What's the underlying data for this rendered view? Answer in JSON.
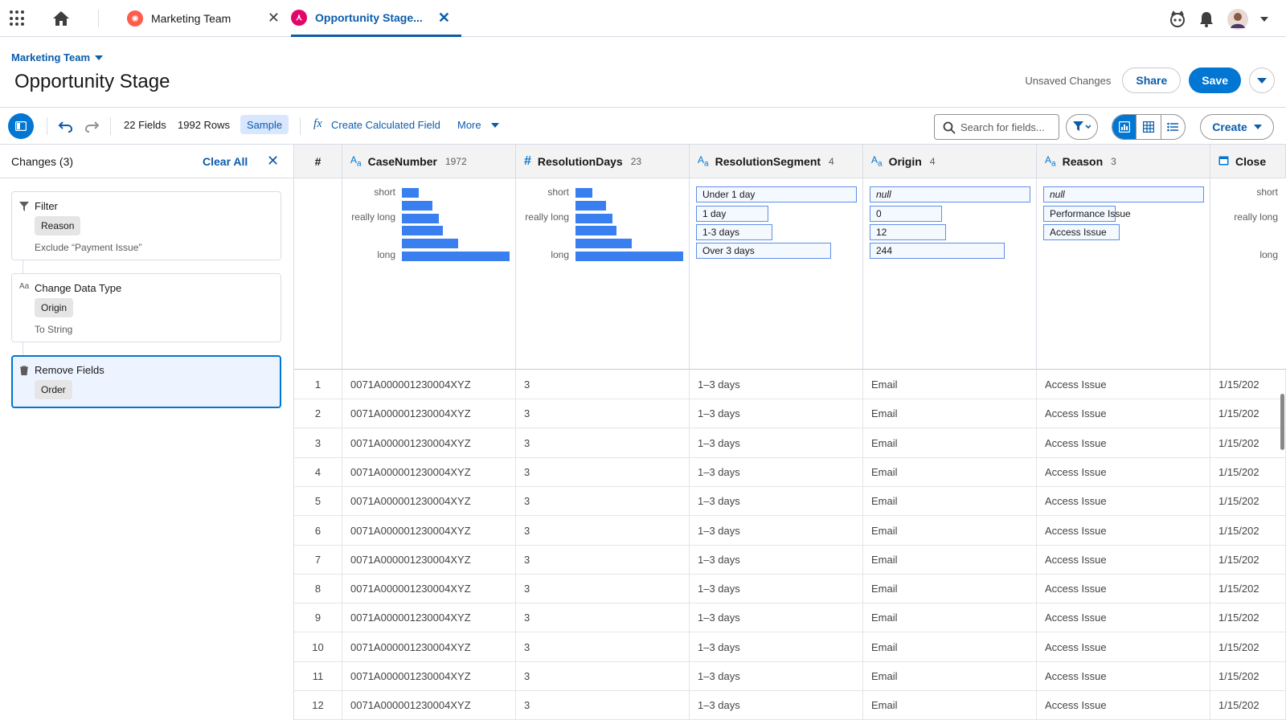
{
  "tabs": [
    {
      "label": "Marketing Team"
    },
    {
      "label": "Opportunity Stage..."
    }
  ],
  "header": {
    "breadcrumb": "Marketing Team",
    "title": "Opportunity Stage",
    "unsaved": "Unsaved Changes",
    "share_label": "Share",
    "save_label": "Save"
  },
  "toolbar": {
    "fields": "22 Fields",
    "rows": "1992 Rows",
    "sample": "Sample",
    "fx": "fx",
    "calc_field": "Create Calculated Field",
    "more": "More",
    "search_placeholder": "Search for fields...",
    "create_label": "Create"
  },
  "changes": {
    "title": "Changes (3)",
    "clear_all": "Clear All",
    "close": "✕",
    "items": [
      {
        "title": "Filter",
        "pill": "Reason",
        "desc": "Exclude “Payment Issue”",
        "icon": "filter-icon"
      },
      {
        "title": "Change Data Type",
        "pill": "Origin",
        "desc": "To String",
        "icon": "text-type-icon"
      },
      {
        "title": "Remove Fields",
        "pill": "Order",
        "desc": "",
        "icon": "trash-icon"
      }
    ]
  },
  "columns": [
    {
      "name": "#",
      "type": "",
      "count": ""
    },
    {
      "name": "CaseNumber",
      "type": "text",
      "count": "1972"
    },
    {
      "name": "ResolutionDays",
      "type": "number",
      "count": "23"
    },
    {
      "name": "ResolutionSegment",
      "type": "text",
      "count": "4"
    },
    {
      "name": "Origin",
      "type": "text",
      "count": "4"
    },
    {
      "name": "Reason",
      "type": "text",
      "count": "3"
    },
    {
      "name": "Close",
      "type": "date",
      "count": ""
    }
  ],
  "profiles": {
    "casenumber": {
      "labels": [
        "short",
        "really long",
        "long"
      ],
      "bar_fractions": [
        0.16,
        0.28,
        0.34,
        0.38,
        0.52,
        1.0
      ]
    },
    "resolutiondays": {
      "labels": [
        "short",
        "really long",
        "long"
      ],
      "bar_fractions": [
        0.16,
        0.28,
        0.34,
        0.38,
        0.52,
        1.0
      ]
    },
    "segment": [
      "Under 1 day",
      "1 day",
      "1-3 days",
      "Over 3 days"
    ],
    "origin": [
      "null",
      "0",
      "12",
      "244"
    ],
    "reason": [
      "null",
      "Performance Issue",
      "Access Issue"
    ],
    "close": {
      "labels": [
        "short",
        "really long",
        "long"
      ]
    }
  },
  "rows": [
    {
      "n": "1",
      "case": "0071A000001230004XYZ",
      "days": "3",
      "seg": "1–3 days",
      "origin": "Email",
      "reason": "Access Issue",
      "close": "1/15/202"
    },
    {
      "n": "2",
      "case": "0071A000001230004XYZ",
      "days": "3",
      "seg": "1–3 days",
      "origin": "Email",
      "reason": "Access Issue",
      "close": "1/15/202"
    },
    {
      "n": "3",
      "case": "0071A000001230004XYZ",
      "days": "3",
      "seg": "1–3 days",
      "origin": "Email",
      "reason": "Access Issue",
      "close": "1/15/202"
    },
    {
      "n": "4",
      "case": "0071A000001230004XYZ",
      "days": "3",
      "seg": "1–3 days",
      "origin": "Email",
      "reason": "Access Issue",
      "close": "1/15/202"
    },
    {
      "n": "5",
      "case": "0071A000001230004XYZ",
      "days": "3",
      "seg": "1–3 days",
      "origin": "Email",
      "reason": "Access Issue",
      "close": "1/15/202"
    },
    {
      "n": "6",
      "case": "0071A000001230004XYZ",
      "days": "3",
      "seg": "1–3 days",
      "origin": "Email",
      "reason": "Access Issue",
      "close": "1/15/202"
    },
    {
      "n": "7",
      "case": "0071A000001230004XYZ",
      "days": "3",
      "seg": "1–3 days",
      "origin": "Email",
      "reason": "Access Issue",
      "close": "1/15/202"
    },
    {
      "n": "8",
      "case": "0071A000001230004XYZ",
      "days": "3",
      "seg": "1–3 days",
      "origin": "Email",
      "reason": "Access Issue",
      "close": "1/15/202"
    },
    {
      "n": "9",
      "case": "0071A000001230004XYZ",
      "days": "3",
      "seg": "1–3 days",
      "origin": "Email",
      "reason": "Access Issue",
      "close": "1/15/202"
    },
    {
      "n": "10",
      "case": "0071A000001230004XYZ",
      "days": "3",
      "seg": "1–3 days",
      "origin": "Email",
      "reason": "Access Issue",
      "close": "1/15/202"
    },
    {
      "n": "11",
      "case": "0071A000001230004XYZ",
      "days": "3",
      "seg": "1–3 days",
      "origin": "Email",
      "reason": "Access Issue",
      "close": "1/15/202"
    },
    {
      "n": "12",
      "case": "0071A000001230004XYZ",
      "days": "3",
      "seg": "1–3 days",
      "origin": "Email",
      "reason": "Access Issue",
      "close": "1/15/202"
    }
  ],
  "colors": {
    "brand": "#0176d3",
    "link": "#0b5cab",
    "bar": "#3a7ff0"
  }
}
